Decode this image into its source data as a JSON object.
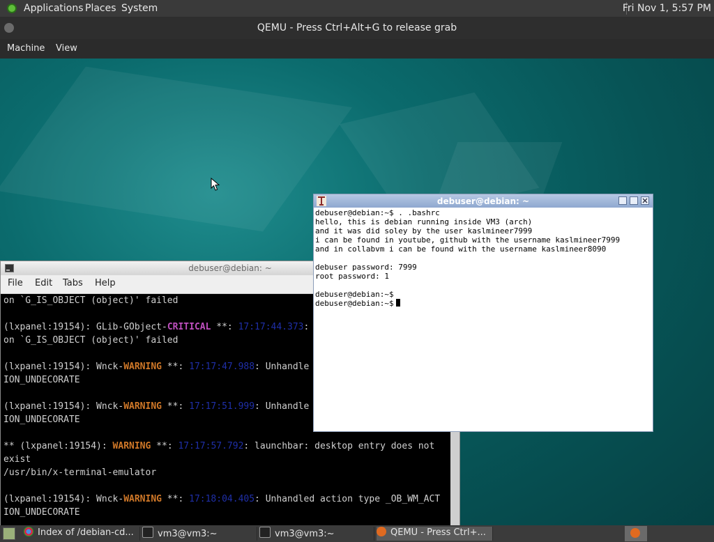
{
  "host_panel": {
    "menus": [
      "Applications",
      "Places",
      "System"
    ],
    "clock": "Fri Nov 1,  5:57 PM"
  },
  "qemu": {
    "title": "QEMU - Press Ctrl+Alt+G to release grab",
    "menus": [
      "Machine",
      "View"
    ]
  },
  "lxterminal": {
    "title": "debuser@debian: ~",
    "menus": [
      "File",
      "Edit",
      "Tabs",
      "Help"
    ],
    "lines": [
      [
        {
          "t": "on `G_IS_OBJECT (object)' failed"
        }
      ],
      [
        {
          "t": ""
        }
      ],
      [
        {
          "t": "(lxpanel:19154): GLib-GObject-"
        },
        {
          "t": "CRITICAL",
          "c": "crit"
        },
        {
          "t": " **: "
        },
        {
          "t": "17:17:44.373",
          "c": "blue"
        },
        {
          "t": ": "
        }
      ],
      [
        {
          "t": "on `G_IS_OBJECT (object)' failed"
        }
      ],
      [
        {
          "t": ""
        }
      ],
      [
        {
          "t": "(lxpanel:19154): Wnck-"
        },
        {
          "t": "WARNING",
          "c": "warn"
        },
        {
          "t": " **: "
        },
        {
          "t": "17:17:47.988",
          "c": "blue"
        },
        {
          "t": ": Unhandle"
        }
      ],
      [
        {
          "t": "ION_UNDECORATE"
        }
      ],
      [
        {
          "t": ""
        }
      ],
      [
        {
          "t": "(lxpanel:19154): Wnck-"
        },
        {
          "t": "WARNING",
          "c": "warn"
        },
        {
          "t": " **: "
        },
        {
          "t": "17:17:51.999",
          "c": "blue"
        },
        {
          "t": ": Unhandle"
        }
      ],
      [
        {
          "t": "ION_UNDECORATE"
        }
      ],
      [
        {
          "t": ""
        }
      ],
      [
        {
          "t": "** (lxpanel:19154): "
        },
        {
          "t": "WARNING",
          "c": "warn"
        },
        {
          "t": " **: "
        },
        {
          "t": "17:17:57.792",
          "c": "blue"
        },
        {
          "t": ": launchbar: desktop entry does not"
        }
      ],
      [
        {
          "t": "exist"
        }
      ],
      [
        {
          "t": "/usr/bin/x-terminal-emulator"
        }
      ],
      [
        {
          "t": ""
        }
      ],
      [
        {
          "t": "(lxpanel:19154): Wnck-"
        },
        {
          "t": "WARNING",
          "c": "warn"
        },
        {
          "t": " **: "
        },
        {
          "t": "17:18:04.405",
          "c": "blue"
        },
        {
          "t": ": Unhandled action type _OB_WM_ACT"
        }
      ],
      [
        {
          "t": "ION_UNDECORATE"
        }
      ]
    ]
  },
  "xterm": {
    "title": "debuser@debian: ~",
    "lines": [
      "debuser@debian:~$ . .bashrc",
      "hello, this is debian running inside VM3 (arch)",
      "and it was did soley by the user kaslmineer7999",
      "i can be found in youtube, github with the username kaslmineer7999",
      "and in collabvm i can be found with the username kaslmineer8090",
      "",
      "debuser password: 7999",
      "root password: 1",
      "",
      "debuser@debian:~$",
      "debuser@debian:~$"
    ]
  },
  "taskbar": {
    "tasks": [
      {
        "label": "Index of /debian-cd...",
        "icon": "chromium-icon"
      },
      {
        "label": "vm3@vm3:~",
        "icon": "terminal-icon"
      },
      {
        "label": "vm3@vm3:~",
        "icon": "terminal-icon"
      },
      {
        "label": "QEMU - Press Ctrl+...",
        "icon": "qemu-icon"
      }
    ]
  },
  "colors": {
    "critical": "#c050c0",
    "warning": "#d07828",
    "timestamp": "#1f2fa8"
  }
}
